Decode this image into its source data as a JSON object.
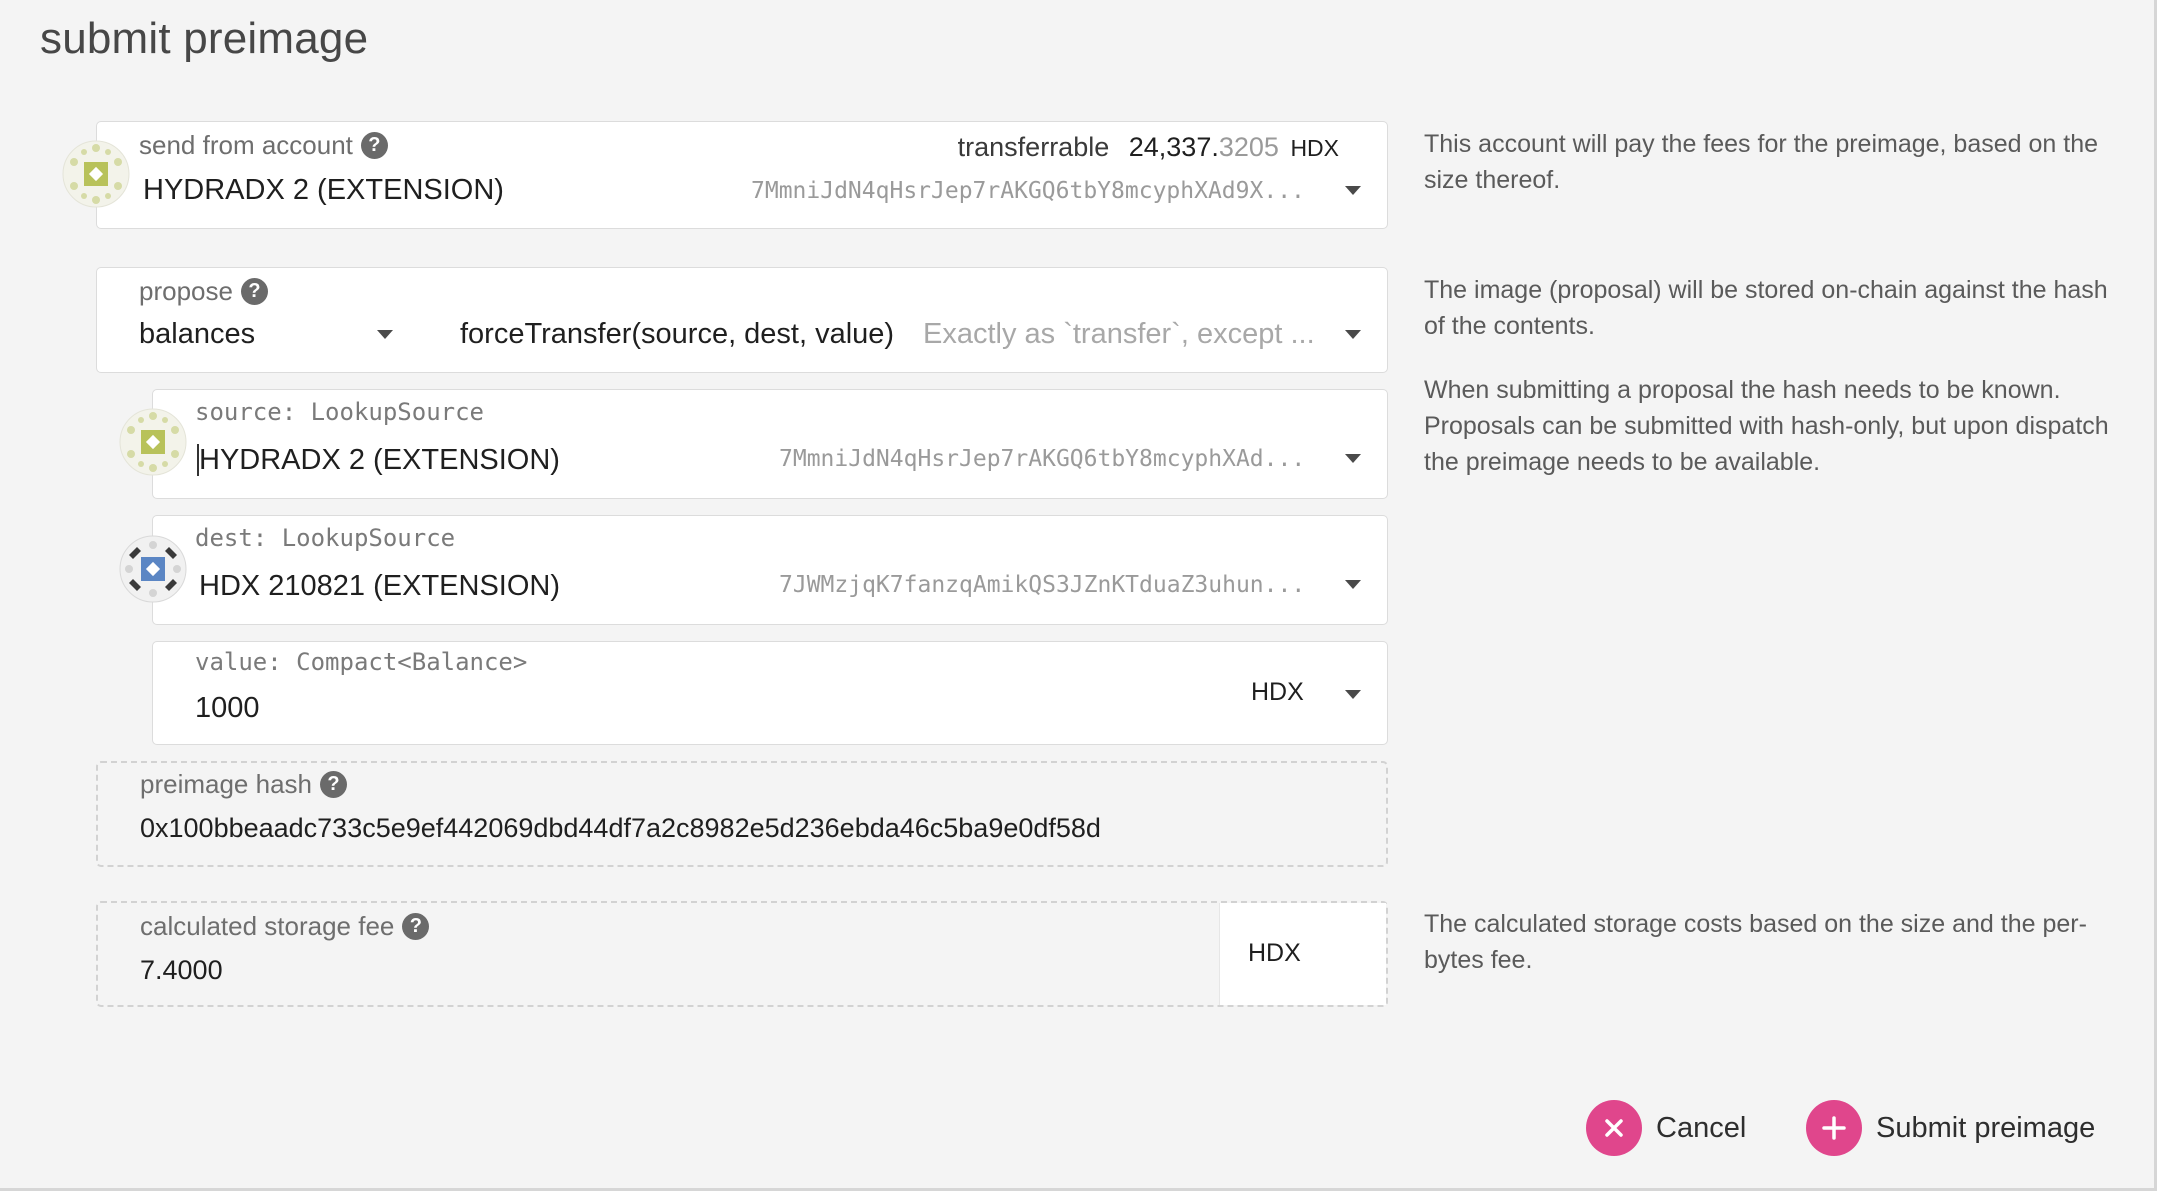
{
  "modal": {
    "title": "submit preimage"
  },
  "send_from": {
    "label": "send from account",
    "account_name": "HYDRADX 2 (EXTENSION)",
    "address": "7MmniJdN4qHsrJep7rAKGQ6tbY8mcyphXAd9X...",
    "transferrable_label": "transferrable",
    "balance_main": "24,337.",
    "balance_decimals": "3205",
    "balance_unit": "HDX",
    "help": "This account will pay the fees for the preimage, based on the size thereof."
  },
  "propose": {
    "label": "propose",
    "section": "balances",
    "method": "forceTransfer(source, dest, value)",
    "method_description": "Exactly as `transfer`, except ...",
    "help_1": "The image (proposal) will be stored on-chain against the hash of the contents.",
    "help_2": "When submitting a proposal the hash needs to be known. Proposals can be submitted with hash-only, but upon dispatch the preimage needs to be available."
  },
  "params": {
    "source": {
      "label": "source: LookupSource",
      "account_name": "HYDRADX 2 (EXTENSION)",
      "address": "7MmniJdN4qHsrJep7rAKGQ6tbY8mcyphXAd..."
    },
    "dest": {
      "label": "dest: LookupSource",
      "account_name": "HDX 210821 (EXTENSION)",
      "address": "7JWMzjqK7fanzqAmikQS3JZnKTduaZ3uhun..."
    },
    "value": {
      "label": "value: Compact<Balance>",
      "amount": "1000",
      "unit": "HDX"
    }
  },
  "preimage_hash": {
    "label": "preimage hash",
    "value": "0x100bbeaadc733c5e9ef442069dbd44df7a2c8982e5d236ebda46c5ba9e0df58d"
  },
  "storage_fee": {
    "label": "calculated storage fee",
    "value": "7.4000",
    "unit": "HDX",
    "help": "The calculated storage costs based on the size and the per-bytes fee."
  },
  "actions": {
    "cancel_label": "Cancel",
    "submit_label": "Submit preimage"
  },
  "colors": {
    "accent": "#e0468c",
    "background": "#f4f4f4",
    "field_background": "#ffffff"
  }
}
